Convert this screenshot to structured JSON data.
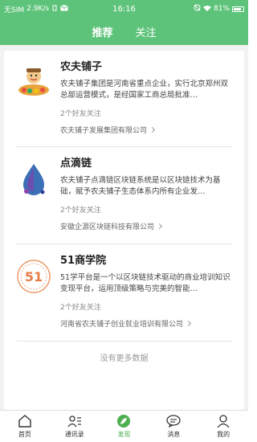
{
  "status": {
    "carrier": "无SIM",
    "speed": "2.9K/s",
    "time": "16:16",
    "battery": "81%"
  },
  "top_tabs": [
    {
      "label": "推荐",
      "active": true
    },
    {
      "label": "关注",
      "active": false
    }
  ],
  "items": [
    {
      "title": "农夫铺子",
      "desc": "农夫铺子集团是河南省重点企业，实行北京郑州双总部运营模式，是经国家工商总局批准…",
      "friends": "2个好友关注",
      "company": "农夫铺子发展集团有限公司"
    },
    {
      "title": "点滴链",
      "desc": "农夫铺子点滴链区块链系统是以区块链技术为基础，赋予农夫铺子生态体系内所有企业发…",
      "friends": "2个好友关注",
      "company": "安徽企源区块链科技有限公司"
    },
    {
      "title": "51商学院",
      "desc": "51学平台是一个以区块链技术驱动的商业培训知识变现平台，运用顶级策略与完美的智能…",
      "friends": "2个好友关注",
      "company": "河南省农夫铺子创业就业培训有限公司"
    }
  ],
  "no_more": "没有更多数据",
  "logo_text": {
    "logo51": "51"
  },
  "tabbar": [
    {
      "label": "首页",
      "icon": "home-icon"
    },
    {
      "label": "通讯录",
      "icon": "contacts-icon"
    },
    {
      "label": "发现",
      "icon": "discover-icon",
      "active": true
    },
    {
      "label": "消息",
      "icon": "message-icon"
    },
    {
      "label": "我的",
      "icon": "profile-icon"
    }
  ],
  "colors": {
    "brand_green": "#5ec37a",
    "active_tab": "#4caf50"
  }
}
